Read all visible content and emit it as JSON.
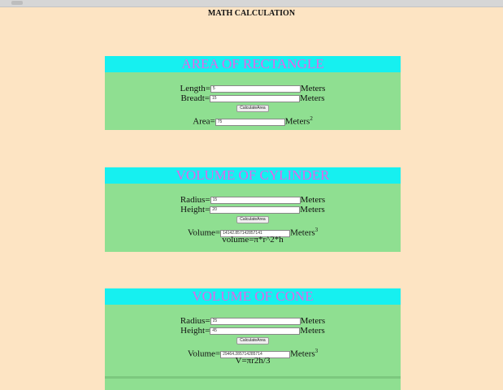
{
  "page_title": "MATH CALCULATION",
  "colors": {
    "background": "#fde4c3",
    "header_bg": "#16f0f0",
    "header_text": "#e266e8",
    "body_bg": "#8fdf91"
  },
  "rectangle": {
    "title": "AREA OF RECTANGLE",
    "length_label": "Length=",
    "length_value": "5",
    "length_unit": "Meters",
    "breadth_label": "Breadt=",
    "breadth_value": "15",
    "breadth_unit": "Meters",
    "button_label": "CalculateArea",
    "area_label": "Area=",
    "area_value": "75",
    "area_unit": "Meters",
    "area_exp": "2"
  },
  "cylinder": {
    "title": "VOLUME OF CYLINDER",
    "radius_label": "Radius=",
    "radius_value": "15",
    "radius_unit": "Meters",
    "height_label": "Height=",
    "height_value": "20",
    "height_unit": "Meters",
    "button_label": "CalculateArea",
    "volume_label": "Volume=",
    "volume_value": "14142.857142857141",
    "volume_unit": "Meters",
    "volume_exp": "3",
    "formula": "volume=π*r^2*h"
  },
  "cone": {
    "title": "VOLUME OF CONE",
    "radius_label": "Radius=",
    "radius_value": "25",
    "radius_unit": "Meters",
    "height_label": "Height=",
    "height_value": "45",
    "height_unit": "Meters",
    "button_label": "CalculateArea",
    "volume_label": "Volume=",
    "volume_value": "29464.285714285714",
    "volume_unit": "Meters",
    "volume_exp": "3",
    "formula": "V=πr2h/3"
  }
}
